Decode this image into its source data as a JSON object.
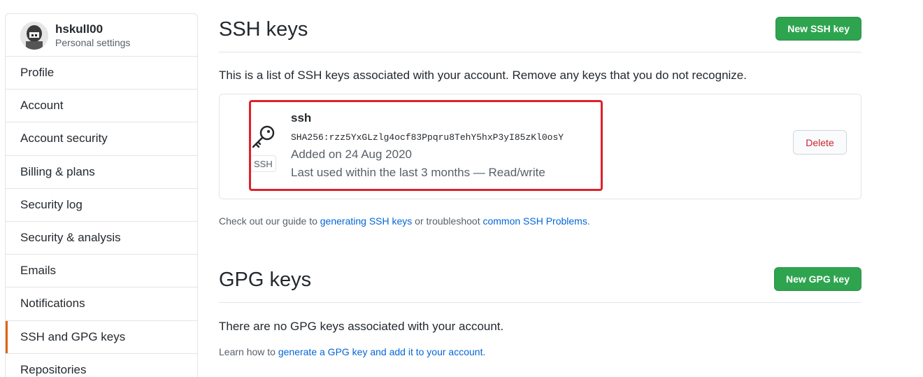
{
  "profile": {
    "username": "hskull00",
    "subtitle": "Personal settings"
  },
  "sidebar": {
    "items": [
      {
        "label": "Profile"
      },
      {
        "label": "Account"
      },
      {
        "label": "Account security"
      },
      {
        "label": "Billing & plans"
      },
      {
        "label": "Security log"
      },
      {
        "label": "Security & analysis"
      },
      {
        "label": "Emails"
      },
      {
        "label": "Notifications"
      },
      {
        "label": "SSH and GPG keys"
      },
      {
        "label": "Repositories"
      }
    ],
    "active_index": 8
  },
  "ssh_section": {
    "title": "SSH keys",
    "new_button": "New SSH key",
    "description": "This is a list of SSH keys associated with your account. Remove any keys that you do not recognize.",
    "keys": [
      {
        "title": "ssh",
        "fingerprint": "SHA256:rzz5YxGLzlg4ocf83Ppqru8TehY5hxP3yI85zKl0osY",
        "added": "Added on 24 Aug 2020",
        "last_used": "Last used within the last 3 months — Read/write",
        "badge": "SSH",
        "delete_label": "Delete"
      }
    ],
    "guide_prefix": "Check out our guide to ",
    "guide_link1": "generating SSH keys",
    "guide_middle": " or troubleshoot ",
    "guide_link2": "common SSH Problems",
    "guide_suffix": "."
  },
  "gpg_section": {
    "title": "GPG keys",
    "new_button": "New GPG key",
    "description": "There are no GPG keys associated with your account.",
    "learn_prefix": "Learn how to ",
    "learn_link": "generate a GPG key and add it to your account",
    "learn_suffix": "."
  },
  "colors": {
    "green": "#2ea44f",
    "link": "#0366d6",
    "danger": "#cb2431",
    "active_marker": "#e36209",
    "highlight": "#e0202a"
  }
}
